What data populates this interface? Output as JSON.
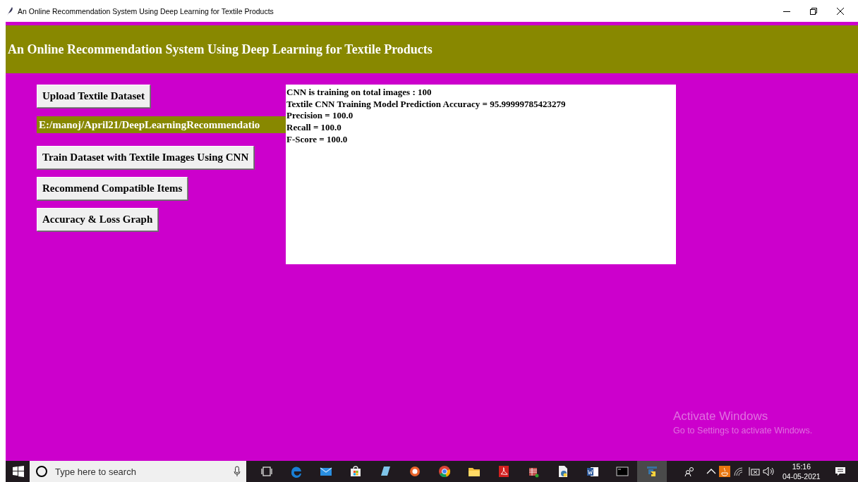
{
  "window": {
    "title": "An Online Recommendation System Using Deep Learning for Textile Products"
  },
  "header": {
    "title": "An Online Recommendation System Using Deep Learning for Textile Products"
  },
  "controls": [
    {
      "kind": "button",
      "label": "Upload Textile Dataset"
    },
    {
      "kind": "label",
      "label": "E:/manoj/April21/DeepLearningRecommendatio"
    },
    {
      "kind": "button",
      "label": "Train Dataset with Textile Images Using CNN"
    },
    {
      "kind": "button",
      "label": "Recommend Compatible Items"
    },
    {
      "kind": "button",
      "label": "Accuracy & Loss Graph"
    }
  ],
  "output": {
    "lines": [
      "CNN is training on total images : 100",
      "Textile CNN Training Model Prediction Accuracy = 95.99999785423279",
      "Precision = 100.0",
      "Recall = 100.0",
      "F-Score = 100.0"
    ]
  },
  "activation_notice": {
    "title": "Activate Windows",
    "message": "Go to Settings to activate Windows."
  },
  "taskbar": {
    "search": {
      "placeholder": "Type here to search"
    },
    "apps": [
      {
        "kind": "taskview",
        "selected": false
      },
      {
        "kind": "edge",
        "selected": false
      },
      {
        "kind": "mail",
        "selected": false
      },
      {
        "kind": "store",
        "selected": false
      },
      {
        "kind": "notepad",
        "selected": false
      },
      {
        "kind": "orange",
        "selected": false
      },
      {
        "kind": "chrome",
        "selected": false
      },
      {
        "kind": "folder",
        "selected": false
      },
      {
        "kind": "pdf",
        "selected": false
      },
      {
        "kind": "tool",
        "selected": false
      },
      {
        "kind": "pyfile",
        "selected": false
      },
      {
        "kind": "word",
        "selected": false
      },
      {
        "kind": "console",
        "selected": false
      },
      {
        "kind": "python",
        "selected": true
      }
    ],
    "time": "15:16",
    "date": "04-05-2021"
  }
}
